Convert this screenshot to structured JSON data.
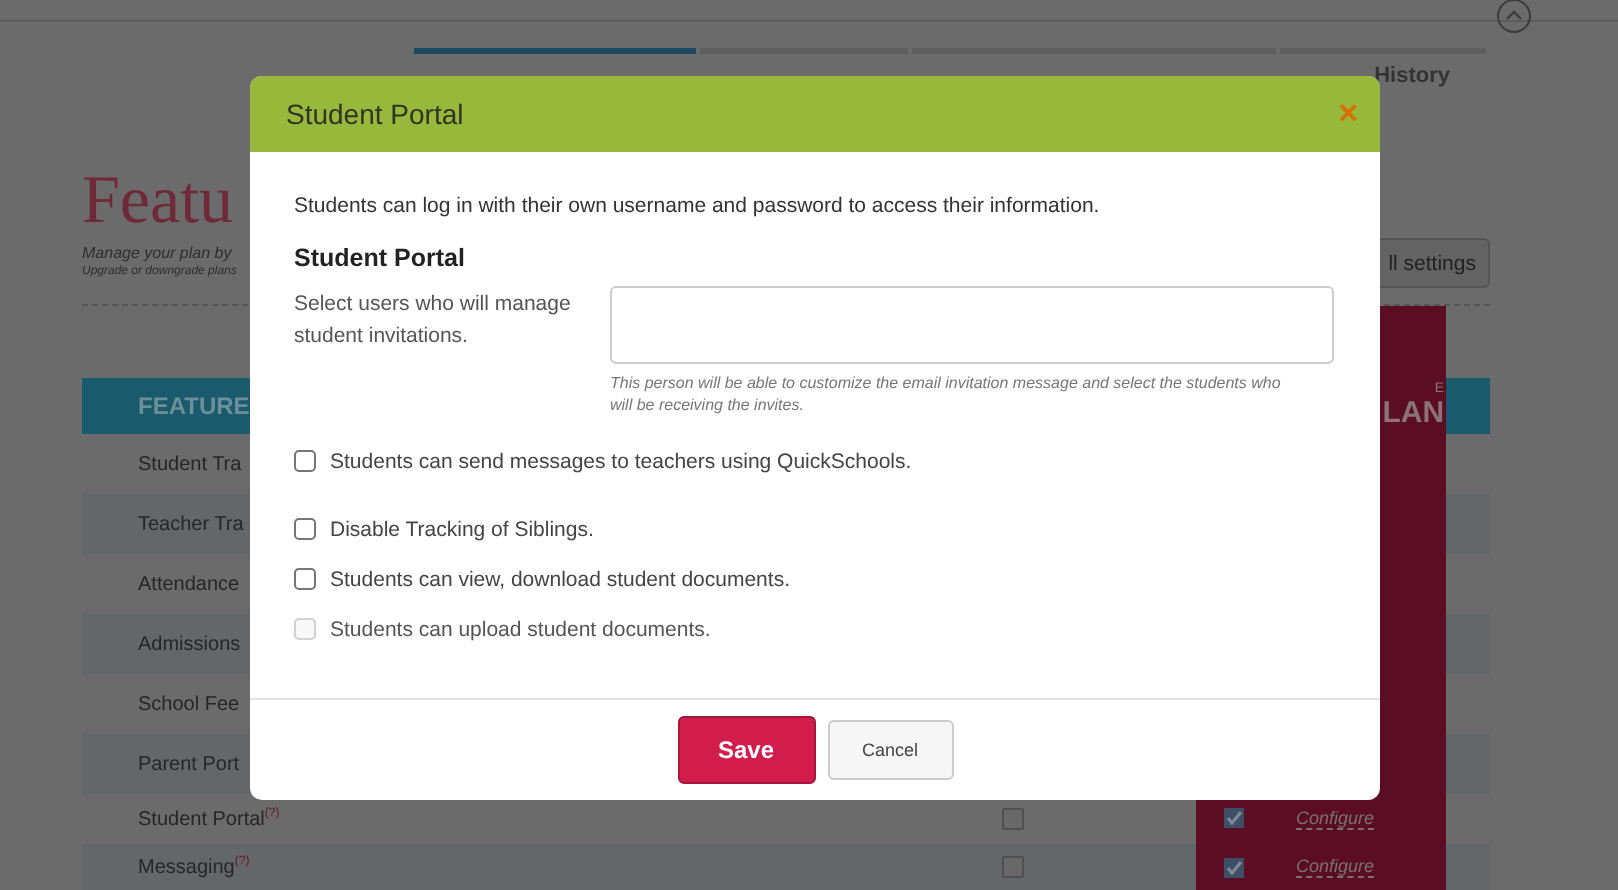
{
  "top_tabs": [
    {
      "selected": true
    },
    {
      "selected": false
    },
    {
      "selected": false
    },
    {
      "label": "History",
      "selected": false
    }
  ],
  "page": {
    "title": "Featu",
    "subtitle": "Manage your plan by",
    "note": "Upgrade or downgrade plans",
    "settings_button": "ll settings"
  },
  "table": {
    "header": "FEATURE",
    "plan_header_small": "E",
    "plan_header": "LAN",
    "rows": [
      {
        "name": "Student Tra"
      },
      {
        "name": "Teacher Tra"
      },
      {
        "name": "Attendance"
      },
      {
        "name": "Admissions"
      },
      {
        "name": "School Fee"
      },
      {
        "name": "Parent Port"
      },
      {
        "name": "Student Portal",
        "help": "(?)",
        "checked": false,
        "plan_checked": true,
        "link": "Configure"
      },
      {
        "name": "Messaging",
        "help": "(?)",
        "checked": false,
        "plan_checked": true,
        "link": "Configure"
      }
    ]
  },
  "modal": {
    "title": "Student Portal",
    "close": "×",
    "intro": "Students can log in with their own username and password to access their information.",
    "section_title": "Student Portal",
    "field_label": "Select users who will manage student invitations.",
    "field_hint": "This person will be able to customize the email invitation message and select the students who will be receiving the invites.",
    "options": [
      {
        "label": "Students can send messages to teachers using QuickSchools.",
        "checked": false,
        "disabled": false
      },
      {
        "label": "Disable Tracking of Siblings.",
        "checked": false,
        "disabled": false
      },
      {
        "label": "Students can view, download student documents.",
        "checked": false,
        "disabled": false
      },
      {
        "label": "Students can upload student documents.",
        "checked": false,
        "disabled": true
      }
    ],
    "save": "Save",
    "cancel": "Cancel"
  }
}
